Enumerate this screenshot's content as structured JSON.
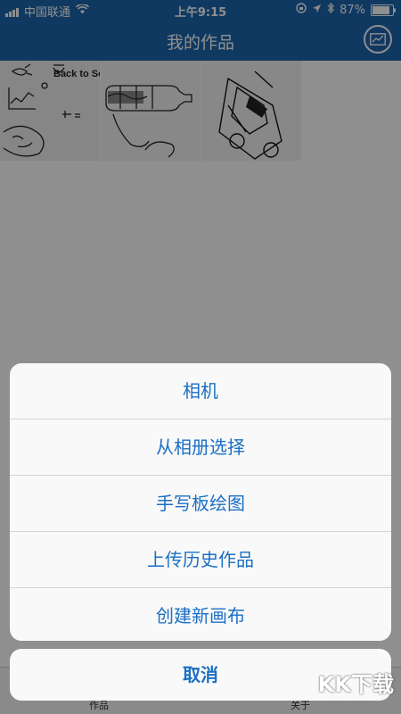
{
  "status": {
    "carrier": "中国联通",
    "time": "上午9:15",
    "battery": "87%",
    "battery_level": 0.87
  },
  "header": {
    "title": "我的作品",
    "chart_icon": "chart-icon"
  },
  "gallery": {
    "items": [
      {
        "name": "back-to-school-sketch",
        "text": "Back to School"
      },
      {
        "name": "bottle-sketch",
        "text": ""
      },
      {
        "name": "car-sketch",
        "text": ""
      }
    ]
  },
  "action_sheet": {
    "actions": [
      "相机",
      "从相册选择",
      "手写板绘图",
      "上传历史作品",
      "创建新画布"
    ],
    "cancel": "取消"
  },
  "tabbar": {
    "left": "作品",
    "right": "关于"
  },
  "watermark": {
    "logo": "KK下载",
    "url": "www.kkx.net"
  },
  "colors": {
    "brand": "#1e66ad",
    "action_text": "#1a6fc4"
  }
}
